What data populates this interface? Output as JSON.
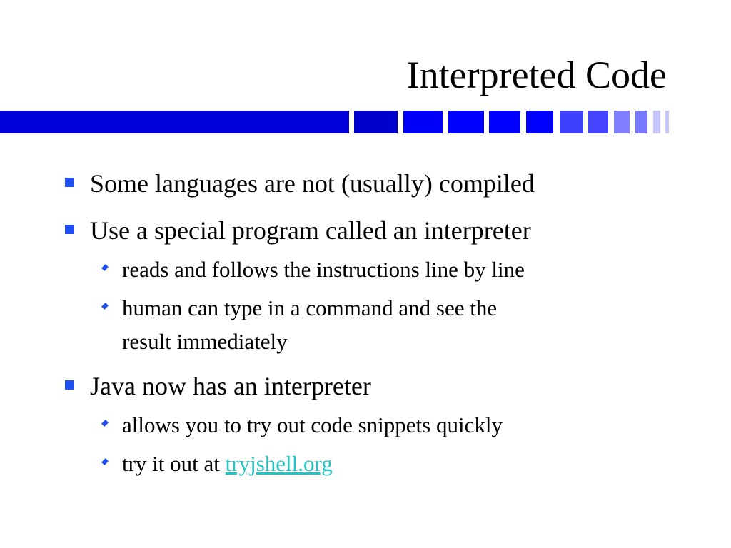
{
  "slide": {
    "title": "Interpreted Code",
    "bullets": [
      {
        "level": 1,
        "text": "Some languages are not (usually) compiled"
      },
      {
        "level": 1,
        "text": "Use a special program called an interpreter"
      },
      {
        "level": 2,
        "text": "reads and follows the instructions line by line"
      },
      {
        "level": 2,
        "text": "human can type in a command and see the",
        "continuation": "result immediately"
      },
      {
        "level": 1,
        "text": "Java now has an interpreter"
      },
      {
        "level": 2,
        "text": "allows you to try out code snippets quickly"
      },
      {
        "level": 2,
        "text": "try it out at ",
        "link_text": "tryjshell.org"
      }
    ]
  },
  "colors": {
    "bar_dark": "#0000CC",
    "bar_mid": "#0000FF",
    "bar_light": "#4040FF",
    "bar_lighter": "#8080FF",
    "bar_faint": "#C4C4FF",
    "bullet": "#2050F0",
    "link": "#22C4C4"
  }
}
